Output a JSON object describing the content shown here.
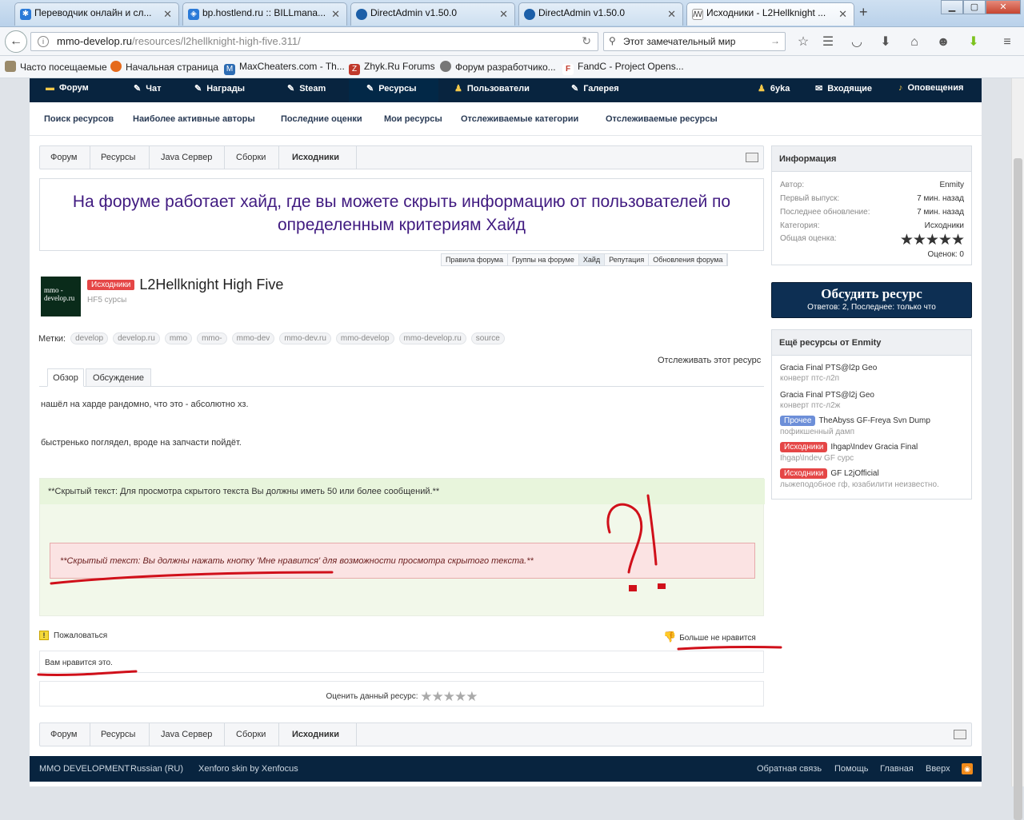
{
  "browser": {
    "tabs": [
      {
        "label": "Переводчик онлайн и сл...",
        "icon": "translator-icon",
        "color": "#2a7ad8"
      },
      {
        "label": "bp.hostlend.ru :: BILLmana...",
        "icon": "billmanager-icon",
        "color": "#2a7ad8"
      },
      {
        "label": "DirectAdmin v1.50.0",
        "icon": "directadmin-icon",
        "color": "#1c5fa8"
      },
      {
        "label": "DirectAdmin v1.50.0",
        "icon": "directadmin-icon",
        "color": "#1c5fa8"
      },
      {
        "label": "Исходники - L2Hellknight ...",
        "icon": "xenforo-icon",
        "color": "#555"
      }
    ],
    "new_tab": "+",
    "url_host": "mmo-develop.ru",
    "url_path": "/resources/l2hellknight-high-five.311/",
    "search_placeholder": "Этот замечательный мир",
    "bookmarks": [
      {
        "label": "Часто посещаемые",
        "icon": "bookmark-icon"
      },
      {
        "label": "Начальная страница",
        "icon": "firefox-icon"
      },
      {
        "label": "MaxCheaters.com - Th...",
        "icon": "maxcheaters-icon"
      },
      {
        "label": "Zhyk.Ru Forums",
        "icon": "zhyk-icon"
      },
      {
        "label": "Форум разработчико...",
        "icon": "forum-icon"
      },
      {
        "label": "FandC - Project Opens...",
        "icon": "fandc-icon"
      }
    ]
  },
  "site": {
    "nav": [
      {
        "label": "Форум",
        "icon": "forum-icon"
      },
      {
        "label": "Чат",
        "icon": "pencil-icon"
      },
      {
        "label": "Награды",
        "icon": "pencil-icon"
      },
      {
        "label": "Steam",
        "icon": "pencil-icon"
      },
      {
        "label": "Ресурсы",
        "icon": "pencil-icon"
      },
      {
        "label": "Пользователи",
        "icon": "users-icon"
      },
      {
        "label": "Галерея",
        "icon": "pencil-icon"
      }
    ],
    "user": {
      "name": "6yka",
      "inbox": "Входящие",
      "alerts": "Оповещения"
    },
    "subnav": [
      "Поиск ресурсов",
      "Наиболее активные авторы",
      "Последние оценки",
      "Мои ресурсы",
      "Отслеживаемые категории",
      "Отслеживаемые ресурсы"
    ],
    "breadcrumbs": [
      "Форум",
      "Ресурсы",
      "Java Сервер",
      "Сборки",
      "Исходники"
    ],
    "notice": {
      "text": "На форуме работает хайд, где вы можете скрыть информацию от пользователей по определенным критериям Хайд",
      "links": [
        "Правила форума",
        "Группы на форуме",
        "Хайд",
        "Репутация",
        "Обновления форума"
      ]
    },
    "resource": {
      "avatar_text": "mmo - develop.ru",
      "prefix": "Исходники",
      "title": "L2Hellknight High Five",
      "subtitle": "HF5 сурсы",
      "tags_label": "Метки:",
      "tags": [
        "develop",
        "develop.ru",
        "mmo",
        "mmo-",
        "mmo-dev",
        "mmo-dev.ru",
        "mmo-develop",
        "mmo-develop.ru",
        "source"
      ],
      "watch": "Отслеживать этот ресурс",
      "tabs": [
        "Обзор",
        "Обсуждение"
      ],
      "desc1": "нашёл на харде рандомно, что это - абсолютно хз.",
      "desc2": "быстренько поглядел, вроде на запчасти пойдёт.",
      "hidden_msgs": "**Скрытый текст: Для просмотра скрытого текста Вы должны иметь 50 или более сообщений.**",
      "hidden_like": "**Скрытый текст: Вы должны нажать кнопку 'Мне нравится' для возможности просмотра скрытого текста.**",
      "report": "Пожаловаться",
      "unlike": "Больше не нравится",
      "likes": "Вам нравится это.",
      "rate_label": "Оценить данный ресурс:",
      "rating": 0
    },
    "info": {
      "title": "Информация",
      "rows": [
        {
          "k": "Автор:",
          "v": "Enmity"
        },
        {
          "k": "Первый выпуск:",
          "v": "7 мин. назад"
        },
        {
          "k": "Последнее обновление:",
          "v": "7 мин. назад"
        },
        {
          "k": "Категория:",
          "v": "Исходники"
        },
        {
          "k": "Общая оценка:",
          "v": ""
        }
      ],
      "score": "Оценок: 0",
      "rating": 0
    },
    "discuss": {
      "title": "Обсудить ресурс",
      "sub": "Ответов: 2, Последнее: только что"
    },
    "more": {
      "title": "Ещё ресурсы от Enmity",
      "items": [
        {
          "prefix": "",
          "prefix_color": "",
          "title": "Gracia Final PTS@l2p Geo",
          "sub": "конверт птс-л2п"
        },
        {
          "prefix": "",
          "prefix_color": "",
          "title": "Gracia Final PTS@l2j Geo",
          "sub": "конверт птс-л2ж"
        },
        {
          "prefix": "Прочее",
          "prefix_color": "#6d8fd8",
          "title": "TheAbyss GF-Freya Svn Dump",
          "sub": "пофикшенный дамп"
        },
        {
          "prefix": "Исходники",
          "prefix_color": "#e54646",
          "title": "Ihgap\\Indev Gracia Final",
          "sub": "Ihgap\\Indev GF сурс"
        },
        {
          "prefix": "Исходники",
          "prefix_color": "#e54646",
          "title": "GF L2jOfficial",
          "sub": "лыжеподобное гф, юзабилити неизвестно."
        }
      ]
    },
    "footer": {
      "left": [
        "MMO DEVELOPMENT",
        "Russian (RU)",
        "Xenforo skin by Xenfocus"
      ],
      "right": [
        "Обратная связь",
        "Помощь",
        "Главная",
        "Вверх"
      ]
    }
  },
  "colors": {
    "nav_bg": "#08243f",
    "prefix_red": "#e54646",
    "notice_text": "#401a80",
    "annotation_red": "#d0101a"
  }
}
